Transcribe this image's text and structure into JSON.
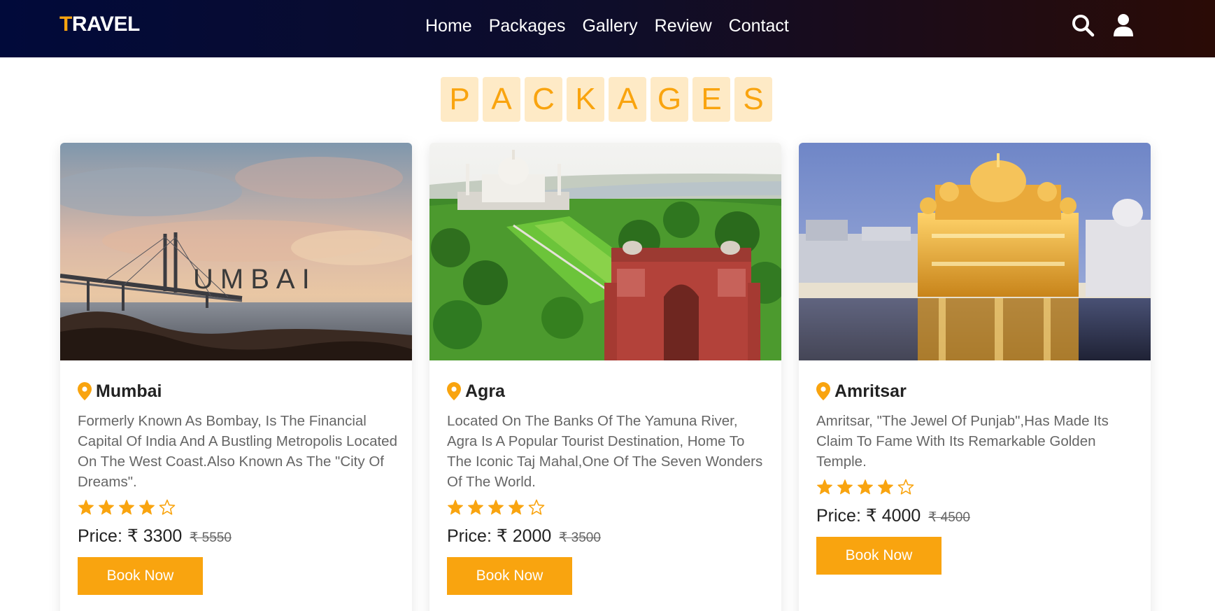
{
  "header": {
    "logo_first": "T",
    "logo_rest": "RAVEL",
    "nav": [
      "Home",
      "Packages",
      "Gallery",
      "Review",
      "Contact"
    ]
  },
  "section": {
    "heading_letters": [
      "P",
      "A",
      "C",
      "K",
      "A",
      "G",
      "E",
      "S"
    ]
  },
  "cards": [
    {
      "image_text": "UMBAI",
      "location": "Mumbai",
      "description": "Formerly Known As Bombay, Is The Financial Capital Of India And A Bustling Metropolis Located On The West Coast.Also Known As The \"City Of Dreams\".",
      "rating": 4,
      "price_label": "Price: ₹ 3300",
      "old_price": "₹ 5550",
      "button": "Book Now"
    },
    {
      "location": "Agra",
      "description": "Located On The Banks Of The Yamuna River, Agra Is A Popular Tourist Destination, Home To The Iconic Taj Mahal,One Of The Seven Wonders Of The World.",
      "rating": 4,
      "price_label": "Price: ₹ 2000",
      "old_price": "₹ 3500",
      "button": "Book Now"
    },
    {
      "location": "Amritsar",
      "description": "Amritsar, \"The Jewel Of Punjab\",Has Made Its Claim To Fame With Its Remarkable Golden Temple.",
      "rating": 4,
      "price_label": "Price: ₹ 4000",
      "old_price": "₹ 4500",
      "button": "Book Now"
    }
  ],
  "colors": {
    "accent": "#f9a40f",
    "heading_bg": "#feeac6",
    "header_start": "#010a3a",
    "header_end": "#2a0b06"
  }
}
